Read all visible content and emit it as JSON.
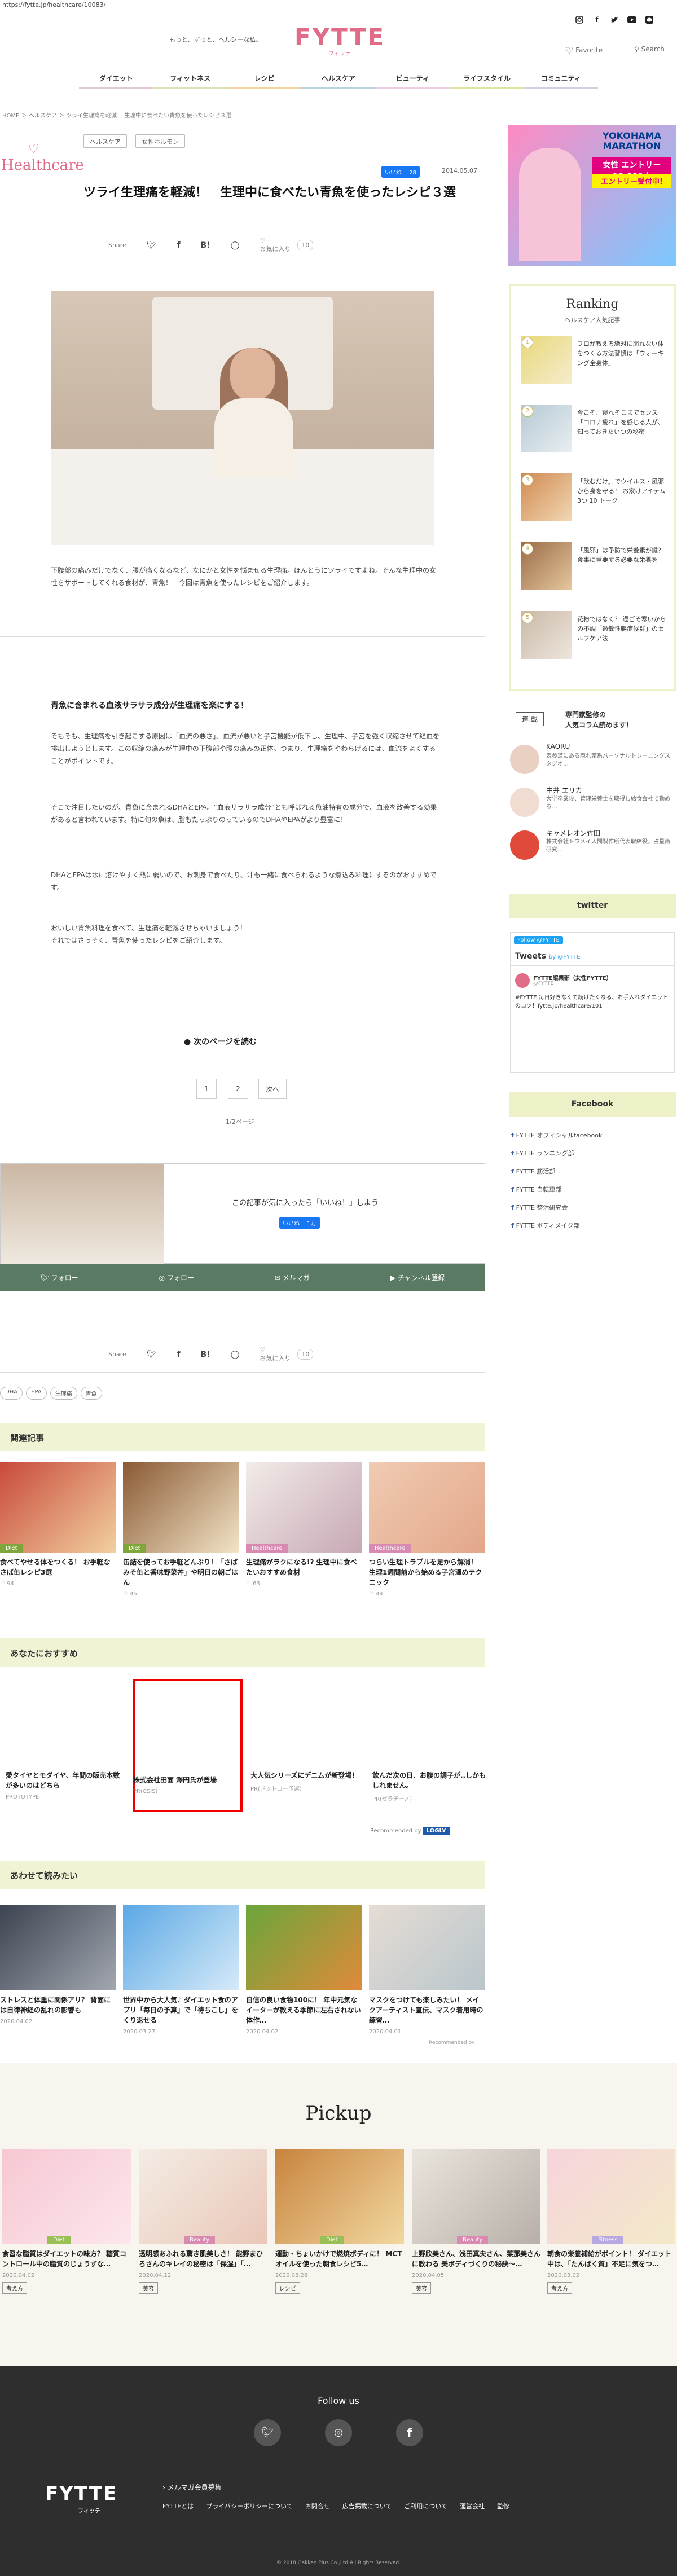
{
  "url": "https://fytte.jp/healthcare/10083/",
  "header": {
    "tagline": "もっと、ずっと、ヘルシーな私。",
    "logo_main": "FYTTE",
    "logo_sub": "フィッテ",
    "favorite": "Favorite",
    "search": "Search",
    "social_icons": [
      "instagram-icon",
      "facebook-icon",
      "twitter-icon",
      "youtube-icon",
      "line-icon"
    ]
  },
  "nav": [
    "ダイエット",
    "フィットネス",
    "レシピ",
    "ヘルスケア",
    "ビューティ",
    "ライフスタイル",
    "コミュニティ"
  ],
  "breadcrumb": "HOME ＞ ヘルスケア ＞ ツライ生理痛を軽減！ 生理中に食べたい青魚を使ったレシピ３選",
  "category": {
    "name": "Healthcare"
  },
  "article": {
    "tags": [
      "ヘルスケア",
      "女性ホルモン"
    ],
    "title": "ツライ生理痛を軽減！　生理中に食べたい青魚を使ったレシピ３選",
    "like_label": "いいね！ 28",
    "date": "2014.05.07",
    "share_label": "Share",
    "fav_label": "お気に入り",
    "fav_count": "10",
    "intro": "下腹部の痛みだけでなく、腰が痛くなるなど、なにかと女性を悩ませる生理痛。ほんとうにツライですよね。そんな生理中の女性をサポートしてくれる食材が、青魚！　今回は青魚を使ったレシピをご紹介します。",
    "h2": "青魚に含まれる血液サラサラ成分が生理痛を楽にする！",
    "p1": "そもそも、生理痛を引き起こする原因は「血流の悪さ」。血流が悪いと子宮機能が低下し、生理中、子宮を強く収縮させて経血を排出しようとします。この収縮の痛みが生理中の下腹部や腰の痛みの正体。つまり、生理痛をやわらげるには、血流をよくすることがポイントです。",
    "p2": "そこで注目したいのが、青魚に含まれるDHAとEPA。“血液サラサラ成分”とも呼ばれる魚油特有の成分で、血液を改善する効果があると言われています。特に旬の魚は、脂もたっぷりのっているのでDHAやEPAがより豊富に！",
    "p3": "DHAとEPAは水に溶けやすく熱に弱いので、お刺身で食べたり、汁も一緒に食べられるような煮込み料理にするのがおすすめです。",
    "p4": "おいしい青魚料理を食べて、生理痛を軽減させちゃいましょう！\nそれではさっそく、青魚を使ったレシピをご紹介します。",
    "next_page": "次のページを読む",
    "pages": [
      "1",
      "2",
      "次へ"
    ],
    "page_status": "1/2ページ",
    "like_prompt": "この記事が気に入ったら「いいね！」しよう",
    "like_small": "いいね！ 1万",
    "follow": [
      "フォロー",
      "フォロー",
      "メルマガ",
      "チャンネル登録"
    ],
    "bottom_tags": [
      "DHA",
      "EPA",
      "生理痛",
      "青魚"
    ]
  },
  "sidebar": {
    "ad": {
      "line1": "YOKOHAMA MARATHON",
      "line2": "女性 エントリー 10,000人",
      "line3": "エントリー受付中!"
    },
    "ranking_title": "Ranking",
    "ranking_sub": "ヘルスケア人気記事",
    "ranking": [
      {
        "n": "1",
        "text": "プロが教える絶対に崩れない体をつくる方法習慣は「ウォーキング全身体」"
      },
      {
        "n": "2",
        "text": "今こそ、寝れそこまでセンス「コロナ疲れ」を感じる人が、知っておきたいつの秘密"
      },
      {
        "n": "3",
        "text": "「飲むだけ」でウイルス・風邪から身を守る！ お家けアイテム3つ 10 トーク"
      },
      {
        "n": "4",
        "text": "「風邪」は予防で栄養素が鍵？ 食事に重要する必要な栄養を"
      },
      {
        "n": "5",
        "text": "花粉ではなく？ 過ごそ寒いからの不調「過敏性腸症候群」のセルフケア法"
      }
    ],
    "writers_badge": "連 載",
    "writers_title": "専門家監修の\n人気コラム読めます！",
    "writers": [
      {
        "name": "KAORU",
        "desc": "表参道にある隠れ家系パーソナルトレーニングスタジオ…"
      },
      {
        "name": "中井 エリカ",
        "desc": "大学卒業後、管理栄養士を取得し給食会社で勤める…"
      },
      {
        "name": "キャメレオン竹田",
        "desc": "株式会社トウメイ人間製作所代表取締役。占星術研究…"
      }
    ],
    "twitter_title": "twitter",
    "twitter_follow": "Follow @FYTTE",
    "tweets_label": "Tweets",
    "tweets_by": "by @FYTTE",
    "tweet_name": "FYTTE編集部（女性FYTTE）",
    "tweet_handle": "@FYTTE",
    "tweet_text": "#FYTTE 毎日好きなくて続けたくなる、お手入れダイエットのコツ！fytte.jp/healthcare/101",
    "facebook_title": "Facebook",
    "fb_links": [
      "FYTTE オフィシャルfacebook",
      "FYTTE ランニング部",
      "FYTTE 筋活部",
      "FYTTE 自転車部",
      "FYTTE 整活研究会",
      "FYTTE ボディメイク部"
    ]
  },
  "related": {
    "title": "関連記事",
    "items": [
      {
        "badge": "Diet",
        "color": "#7fa63a",
        "text": "食べてやせる体をつくる！ お手軽なさば缶レシピ3選",
        "meta": "94"
      },
      {
        "badge": "Diet",
        "color": "#7fa63a",
        "text": "缶詰を使ってお手軽どんぶり！「さばみそ缶と香味野菜丼」や明日の朝ごはん",
        "meta": "45"
      },
      {
        "badge": "Healthcare",
        "color": "#d98ab0",
        "text": "生理痛がラクになる!? 生理中に食べたいおすすめ食材",
        "meta": "63"
      },
      {
        "badge": "Healthcare",
        "color": "#d98ab0",
        "text": "つらい生理トラブルを足から解消！ 生理1週間前から始める子宮温めテクニック",
        "meta": "44"
      }
    ]
  },
  "recommend": {
    "title": "あなたにおすすめ",
    "items": [
      {
        "text": "愛タイヤとモダイヤ、年間の販売本数が多いのはどちら",
        "src": "PROTOTYPE"
      },
      {
        "text": "株式会社田面 澤円氏が登場",
        "src": "PR(CSIS)"
      },
      {
        "text": "大人気シリーズにデニムが新登場！",
        "src": "PR(ドットコー予選)"
      },
      {
        "text": "飲んだ次の日、お腹の調子が..しかもしれません。",
        "src": "PR(ゼラチーノ)"
      }
    ],
    "recommended_by": "Recommended by",
    "logly": "LOGLY"
  },
  "also_read": {
    "title": "あわせて読みたい",
    "items": [
      {
        "text": "ストレスと体重に関係アリ？ 背面には自律神経の乱れの影響も",
        "date": "2020.04.02"
      },
      {
        "text": "世界中から大人気♪ ダイエット食のアプリ「毎日の予算」で「待ちこし」をくり返せる",
        "date": "2020.03.27"
      },
      {
        "text": "自信の良い食物100に！ 年中元気なイーターが教える季節に左右されない体作…",
        "date": "2020.04.02"
      },
      {
        "text": "マスクをつけても楽しみたい！ メイクアーティスト直伝、マスク着用時の練習…",
        "date": "2020.04.01"
      }
    ],
    "recommended_by": "Recommended by"
  },
  "pickup": {
    "title": "Pickup",
    "items": [
      {
        "badge": "Diet",
        "color": "#9bbf57",
        "text": "食習な脂質はダイエットの味方？ 糖質コントロール中の脂質のじょうずな…",
        "date": "2020.04.02",
        "tag": "考え方"
      },
      {
        "badge": "Beauty",
        "color": "#d98ab0",
        "text": "透明感あふれる驚き肌美しさ！ 能野まひろさんのキレイの秘密は「保湿」「…",
        "date": "2020.04.12",
        "tag": "美容"
      },
      {
        "badge": "Diet",
        "color": "#9bbf57",
        "text": "運動・ちょいかけで燃焼ボディに！ MCTオイルを使った朝食レシピ5…",
        "date": "2020.03.28",
        "tag": "レシピ"
      },
      {
        "badge": "Beauty",
        "color": "#d98ab0",
        "text": "上野欣美さん、浅田真央さん、菜那美さんに教わる 美ボディづくりの秘訣～…",
        "date": "2020.04.05",
        "tag": "美容"
      },
      {
        "badge": "Fitness",
        "color": "#b7a9e0",
        "text": "朝食の栄養補給がポイント！ ダイエット中は、「たんぱく質」不足に気をつ…",
        "date": "2020.03.02",
        "tag": "考え方"
      }
    ]
  },
  "footer": {
    "follow_us": "Follow us",
    "logo": "FYTTE",
    "logo_sub": "フィッテ",
    "mailmag": "メルマガ会員募集",
    "links": [
      "FYTTEとは",
      "プライバシーポリシーについて",
      "お問合せ",
      "広告掲載について",
      "ご利用について",
      "運営会社",
      "監修"
    ],
    "copyright": "© 2018 Gakken Plus Co.,Ltd All Rights Reserved."
  }
}
